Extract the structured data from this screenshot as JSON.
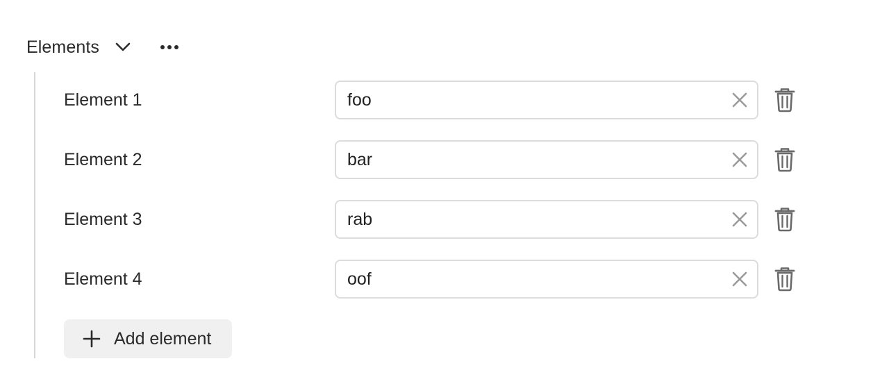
{
  "section": {
    "title": "Elements",
    "toggle_icon": "chevron-down-icon",
    "menu_icon": "more-horizontal-icon"
  },
  "elements": [
    {
      "label": "Element 1",
      "value": "foo"
    },
    {
      "label": "Element 2",
      "value": "bar"
    },
    {
      "label": "Element 3",
      "value": "rab"
    },
    {
      "label": "Element 4",
      "value": "oof"
    }
  ],
  "add_button": {
    "label": "Add element",
    "icon": "plus-icon"
  },
  "colors": {
    "text": "#2a2a2a",
    "border": "#dcdcdc",
    "clear_icon": "#9a9a9a",
    "delete_icon": "#6a6a6a",
    "add_button_bg": "#f0f0f0",
    "rail": "#d6d6d6"
  }
}
